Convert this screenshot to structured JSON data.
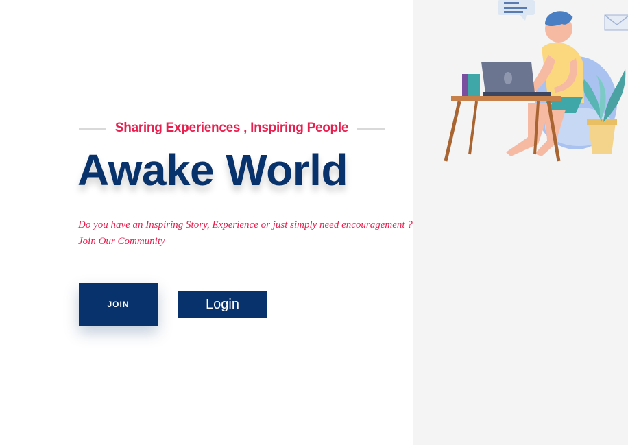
{
  "hero": {
    "tagline": "Sharing Experiences , Inspiring People",
    "title": "Awake World",
    "description_line1": "Do you have an Inspiring Story, Experience or just simply need encouragement ?",
    "description_line2": "Join Our Community"
  },
  "actions": {
    "join_label": "JOIN",
    "login_label": "Login"
  },
  "illustration": {
    "subject": "person-working-on-laptop-illustration"
  },
  "colors": {
    "accent": "#e8204f",
    "primary": "#08326b",
    "panel_bg": "#f4f4f4"
  }
}
